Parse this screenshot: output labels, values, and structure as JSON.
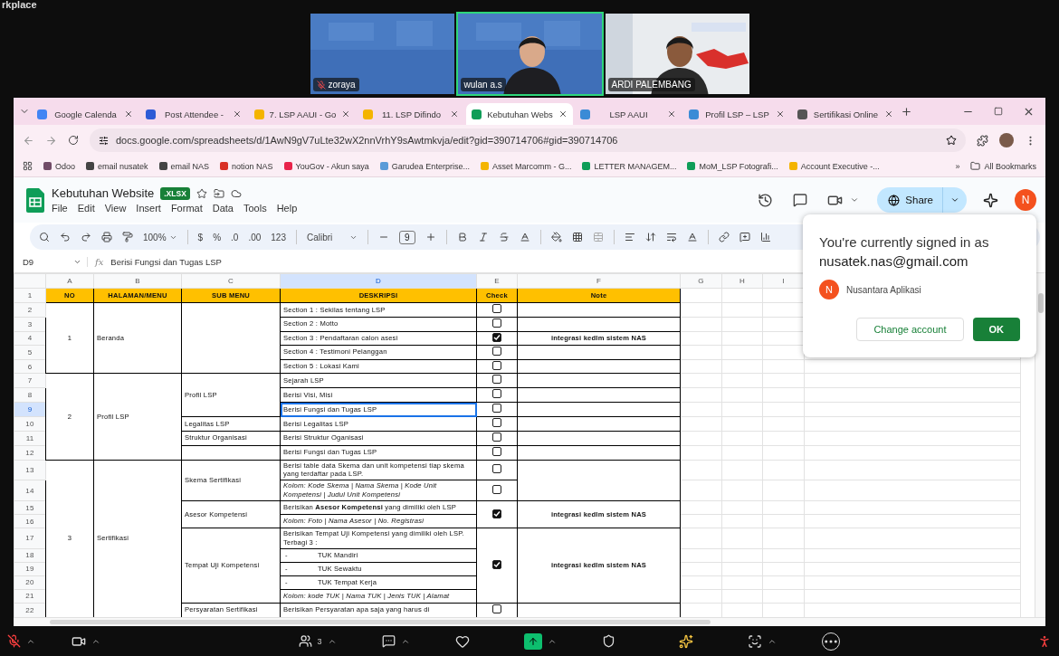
{
  "screen_fragment": "rkplace",
  "participants": [
    {
      "name": "zoraya",
      "kind": "empty",
      "muted": true,
      "speaking": false
    },
    {
      "name": "wulan a.s",
      "kind": "person",
      "muted": false,
      "speaking": true
    },
    {
      "name": "ARDI PALEMBANG",
      "kind": "person",
      "muted": false,
      "speaking": false
    }
  ],
  "browser": {
    "tabs": [
      {
        "title": "Google Calenda",
        "color": "#4285f4",
        "selected": false
      },
      {
        "title": "Post Attendee -",
        "color": "#2d5bd6",
        "selected": false
      },
      {
        "title": "7. LSP AAUI - Go",
        "color": "#f4b400",
        "selected": false
      },
      {
        "title": "11. LSP Difindo",
        "color": "#f4b400",
        "selected": false
      },
      {
        "title": "Kebutuhan Webs",
        "color": "#0f9d58",
        "selected": true
      },
      {
        "title": "LSP AAUI",
        "color": "#3b8bd6",
        "selected": false
      },
      {
        "title": "Profil LSP – LSP",
        "color": "#3b8bd6",
        "selected": false
      },
      {
        "title": "Sertifikasi Online",
        "color": "#555555",
        "selected": false
      }
    ],
    "address": "docs.google.com/spreadsheets/d/1AwN9gV7uLte32wX2nnVrhY9sAwtmkvja/edit?gid=390714706#gid=390714706",
    "bookmarks": [
      {
        "label": "Odoo",
        "color": "#714b67"
      },
      {
        "label": "email nusatek",
        "color": "#444444"
      },
      {
        "label": "email NAS",
        "color": "#444444"
      },
      {
        "label": "notion NAS",
        "color": "#d93025"
      },
      {
        "label": "YouGov - Akun saya",
        "color": "#e8234a"
      },
      {
        "label": "Garudea Enterprise...",
        "color": "#5a9bd8"
      },
      {
        "label": "Asset Marcomm - G...",
        "color": "#f4b400"
      },
      {
        "label": "LETTER MANAGEM...",
        "color": "#0f9d58"
      },
      {
        "label": "MoM_LSP Fotografi...",
        "color": "#0f9d58"
      },
      {
        "label": "Account Executive -...",
        "color": "#f4b400"
      }
    ],
    "more": "»",
    "all_bookmarks": "All Bookmarks"
  },
  "sheet": {
    "title": "Kebutuhan Website",
    "badge": ".XLSX",
    "menus": [
      "File",
      "Edit",
      "View",
      "Insert",
      "Format",
      "Data",
      "Tools",
      "Help"
    ],
    "share": "Share",
    "avatar": "N",
    "toolbar": {
      "zoom": "100%",
      "currency": "$",
      "percent": "%",
      "dec_less": ".0",
      "dec_more": ".00",
      "number_format": "123",
      "font": "Calibri",
      "font_size": "9"
    },
    "name_box": "D9",
    "fx": "fx",
    "formula": "Berisi Fungsi dan Tugas LSP",
    "columns": [
      {
        "label": "A",
        "selected": false
      },
      {
        "label": "B",
        "selected": false
      },
      {
        "label": "C",
        "selected": false
      },
      {
        "label": "D",
        "selected": true
      },
      {
        "label": "E",
        "selected": false
      },
      {
        "label": "F",
        "selected": false
      },
      {
        "label": "G",
        "selected": false
      },
      {
        "label": "H",
        "selected": false
      },
      {
        "label": "I",
        "selected": false
      }
    ],
    "rows": [
      {
        "number": "1",
        "selected": false,
        "cells": [
          {
            "kind": "header",
            "text": "NO"
          },
          {
            "kind": "header",
            "text": "HALAMAN/MENU"
          },
          {
            "kind": "header",
            "text": "SUB MENU"
          },
          {
            "kind": "header",
            "text": "DESKRIPSI"
          },
          {
            "kind": "header",
            "text": "Check"
          },
          {
            "kind": "header",
            "text": "Note"
          }
        ]
      },
      {
        "number": "2",
        "selected": false,
        "cells": [
          {
            "kind": "number",
            "text": "1",
            "rowspan": 5
          },
          {
            "kind": "text",
            "text": "Beranda",
            "rowspan": 5
          },
          {
            "kind": "empty",
            "rowspan": 5
          },
          {
            "kind": "desc",
            "text": "Section 1 : Sekilas tentang LSP"
          },
          {
            "kind": "check",
            "checked": false
          },
          {
            "kind": "empty"
          }
        ]
      },
      {
        "number": "3",
        "selected": false,
        "cells": [
          {
            "kind": "desc",
            "text": "Section 2 : Motto"
          },
          {
            "kind": "check",
            "checked": false
          },
          {
            "kind": "empty"
          }
        ]
      },
      {
        "number": "4",
        "selected": false,
        "cells": [
          {
            "kind": "desc",
            "text": "Section 3 : Pendaftaran calon asesi"
          },
          {
            "kind": "check",
            "checked": true
          },
          {
            "kind": "remark",
            "text": "integrasi kedlm sistem NAS"
          }
        ]
      },
      {
        "number": "5",
        "selected": false,
        "cells": [
          {
            "kind": "desc",
            "text": "Section 4 : Testimoni Pelanggan"
          },
          {
            "kind": "check",
            "checked": false
          },
          {
            "kind": "empty"
          }
        ]
      },
      {
        "number": "6",
        "selected": false,
        "cells": [
          {
            "kind": "desc",
            "text": "Section 5 : Lokasi Kami"
          },
          {
            "kind": "check",
            "checked": false
          },
          {
            "kind": "empty"
          }
        ]
      },
      {
        "number": "7",
        "selected": false,
        "cells": [
          {
            "kind": "number",
            "text": "2",
            "rowspan": 6
          },
          {
            "kind": "text",
            "text": "Profil LSP",
            "rowspan": 6
          },
          {
            "kind": "text",
            "text": "Profil LSP",
            "rowspan": 3
          },
          {
            "kind": "desc",
            "text": "Sejarah LSP"
          },
          {
            "kind": "check",
            "checked": false
          },
          {
            "kind": "empty"
          }
        ]
      },
      {
        "number": "8",
        "selected": false,
        "cells": [
          {
            "kind": "desc",
            "text": "Berisi Visi, Misi"
          },
          {
            "kind": "check",
            "checked": false
          },
          {
            "kind": "empty"
          }
        ]
      },
      {
        "number": "9",
        "selected": true,
        "cells": [
          {
            "kind": "desc",
            "text": "Berisi Fungsi dan Tugas LSP",
            "selected": true
          },
          {
            "kind": "check",
            "checked": false
          },
          {
            "kind": "empty"
          }
        ]
      },
      {
        "number": "10",
        "selected": false,
        "cells": [
          {
            "kind": "text",
            "text": "Legalitas LSP"
          },
          {
            "kind": "desc",
            "text": "Berisi Legalitas LSP"
          },
          {
            "kind": "check",
            "checked": false
          },
          {
            "kind": "empty"
          }
        ]
      },
      {
        "number": "11",
        "selected": false,
        "cells": [
          {
            "kind": "text",
            "text": "Struktur Organisasi"
          },
          {
            "kind": "desc",
            "text": "Berisi Struktur Oganisasi"
          },
          {
            "kind": "check",
            "checked": false
          },
          {
            "kind": "empty"
          }
        ]
      },
      {
        "number": "12",
        "selected": false,
        "cells": [
          {
            "kind": "empty"
          },
          {
            "kind": "desc",
            "text": "Berisi Fungsi dan Tugas LSP"
          },
          {
            "kind": "check",
            "checked": false
          },
          {
            "kind": "empty"
          }
        ]
      },
      {
        "number": "13",
        "selected": false,
        "cells": [
          {
            "kind": "number",
            "text": "3",
            "rowspan": 10
          },
          {
            "kind": "text",
            "text": "Sertifikasi",
            "rowspan": 10
          },
          {
            "kind": "text",
            "text": "Skema Sertifikasi",
            "rowspan": 2
          },
          {
            "kind": "desc",
            "text": "Berisi table data Skema dan unit kompetensi tiap skema yang terdaftar pada LSP."
          },
          {
            "kind": "check",
            "checked": false
          },
          {
            "kind": "empty",
            "rowspan": 2
          }
        ]
      },
      {
        "number": "14",
        "selected": false,
        "cells": [
          {
            "kind": "note",
            "text": "Kolom: Kode Skema | Nama Skema | Kode Unit Kompetensi | Judul Unit Kompetensi"
          },
          {
            "kind": "check",
            "checked": false
          }
        ]
      },
      {
        "number": "15",
        "selected": false,
        "cells": [
          {
            "kind": "text",
            "text": "Asesor Kompetensi",
            "rowspan": 2
          },
          {
            "kind": "desc",
            "text": "Berisikan **Asesor Kompetensi** yang dimiliki oleh LSP"
          },
          {
            "kind": "check",
            "checked": true,
            "rowspan": 2
          },
          {
            "kind": "remark",
            "text": "integrasi kedlm sistem NAS",
            "rowspan": 2
          }
        ]
      },
      {
        "number": "16",
        "selected": false,
        "cells": [
          {
            "kind": "note",
            "text": "Kolom: Foto | Nama Asesor | No. Registrasi"
          }
        ]
      },
      {
        "number": "17",
        "selected": false,
        "cells": [
          {
            "kind": "text",
            "text": "Tempat Uji Kompetensi",
            "rowspan": 5
          },
          {
            "kind": "desc",
            "text": "Berisikan Tempat Uji Kompetensi yang dimiliki oleh LSP. Terbagi 3 :"
          },
          {
            "kind": "check",
            "checked": true,
            "rowspan": 5
          },
          {
            "kind": "remark",
            "text": "integrasi kedlm sistem NAS",
            "rowspan": 5
          }
        ]
      },
      {
        "number": "18",
        "selected": false,
        "cells": [
          {
            "kind": "bullet",
            "bullet": "-",
            "text": "TUK Mandiri"
          }
        ]
      },
      {
        "number": "19",
        "selected": false,
        "cells": [
          {
            "kind": "bullet",
            "bullet": "-",
            "text": "TUK Sewaktu"
          }
        ]
      },
      {
        "number": "20",
        "selected": false,
        "cells": [
          {
            "kind": "bullet",
            "bullet": "-",
            "text": "TUK Tempat Kerja"
          }
        ]
      },
      {
        "number": "21",
        "selected": false,
        "cells": [
          {
            "kind": "note",
            "text": "Kolom: kode TUK | Nama TUK | Jenis TUK | Alamat"
          }
        ]
      },
      {
        "number": "22",
        "selected": false,
        "cells": [
          {
            "kind": "text",
            "text": "Persyaratan Sertifikasi"
          },
          {
            "kind": "desc",
            "text": "Berisikan Persyaratan apa saja yang harus di"
          },
          {
            "kind": "check",
            "checked": false
          },
          {
            "kind": "empty"
          }
        ]
      }
    ]
  },
  "dialog": {
    "message": "You're currently signed in as",
    "email": "nusatek.nas@gmail.com",
    "avatar": "N",
    "account": "Nusantara Aplikasi",
    "secondary": "Change account",
    "primary": "OK"
  },
  "call_bar": {
    "participant_count": "3"
  }
}
